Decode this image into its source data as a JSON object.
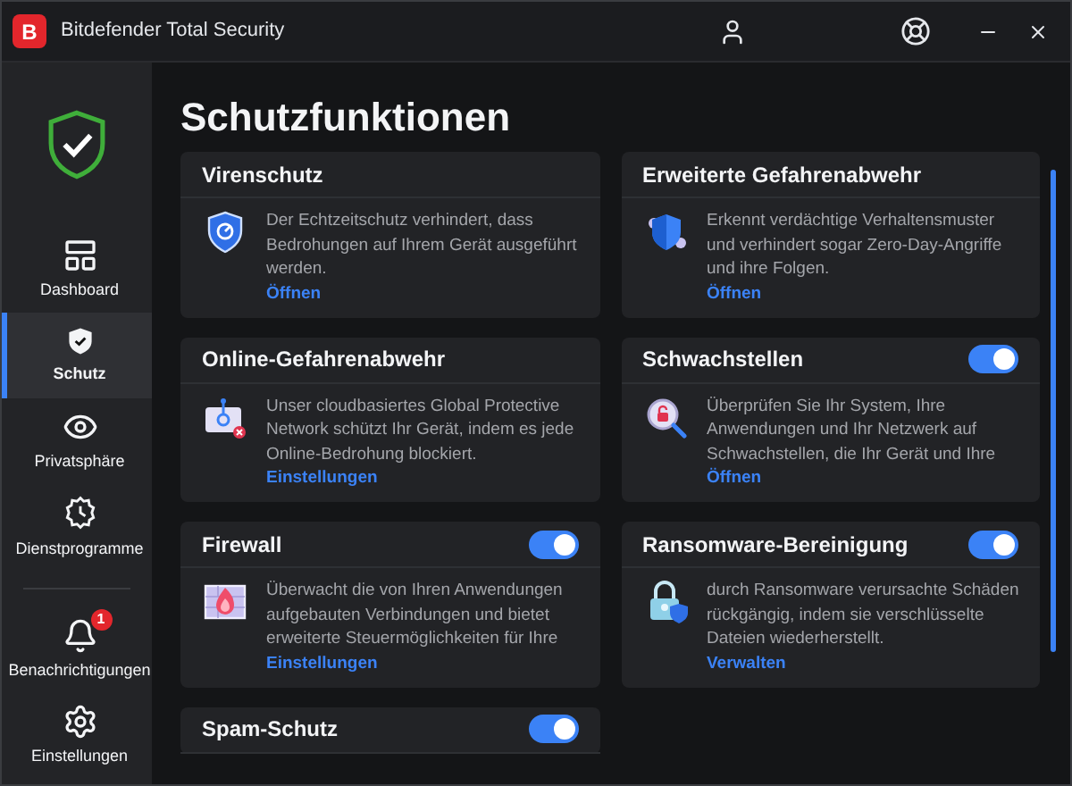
{
  "window": {
    "title": "Bitdefender Total Security",
    "logo": "B"
  },
  "sidebar": {
    "items": [
      {
        "label": "Dashboard",
        "selected": false
      },
      {
        "label": "Schutz",
        "selected": true
      },
      {
        "label": "Privatsphäre",
        "selected": false
      },
      {
        "label": "Dienstprogramme",
        "selected": false
      },
      {
        "label": "Benachrichtigungen",
        "selected": false,
        "badge": "1"
      },
      {
        "label": "Einstellungen",
        "selected": false
      }
    ]
  },
  "page": {
    "title": "Schutzfunktionen"
  },
  "cards": [
    {
      "title": "Virenschutz",
      "description": "Der Echtzeitschutz verhindert, dass Bedrohungen auf Ihrem Gerät ausgeführt werden.",
      "link": "Öffnen"
    },
    {
      "title": "Erweiterte Gefahrenabwehr",
      "description": "Erkennt verdächtige Verhaltensmuster und verhindert sogar Zero-Day-Angriffe und ihre Folgen.",
      "link": "Öffnen"
    },
    {
      "title": "Online-Gefahrenabwehr",
      "description": "Unser cloudbasiertes Global Protective Network schützt Ihr Gerät, indem es jede Online-Bedrohung blockiert.",
      "link": "Einstellungen"
    },
    {
      "title": "Schwachstellen",
      "on": true,
      "description": "Überprüfen Sie Ihr System, Ihre Anwendungen und Ihr Netzwerk auf Schwachstellen, die Ihr Gerät und Ihre",
      "link": "Öffnen"
    },
    {
      "title": "Firewall",
      "on": true,
      "description": "Überwacht die von Ihren Anwendungen aufgebauten Verbindungen und bietet erweiterte Steuermöglichkeiten für Ihre",
      "link": "Einstellungen"
    },
    {
      "title": "Ransomware-Bereinigung",
      "on": true,
      "description": "durch Ransomware verursachte Schäden rückgängig, indem sie verschlüsselte Dateien wiederherstellt.",
      "link": "Verwalten"
    },
    {
      "title": "Spam-Schutz",
      "on": true
    }
  ]
}
